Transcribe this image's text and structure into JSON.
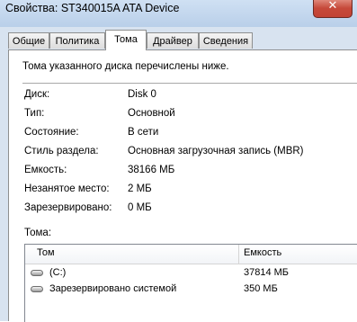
{
  "window": {
    "title": "Свойства: ST340015A ATA Device",
    "close_symbol": "✕"
  },
  "tabs": [
    {
      "label": "Общие"
    },
    {
      "label": "Политика"
    },
    {
      "label": "Тома"
    },
    {
      "label": "Драйвер"
    },
    {
      "label": "Сведения"
    }
  ],
  "active_tab": "Тома",
  "volumes_page": {
    "description": "Тома указанного диска перечислены ниже.",
    "fields": [
      {
        "label": "Диск:",
        "value": "Disk 0"
      },
      {
        "label": "Тип:",
        "value": "Основной"
      },
      {
        "label": "Состояние:",
        "value": "В сети"
      },
      {
        "label": "Стиль раздела:",
        "value": "Основная загрузочная запись (MBR)"
      },
      {
        "label": "Емкость:",
        "value": "38166 МБ"
      },
      {
        "label": "Незанятое место:",
        "value": "2 МБ"
      },
      {
        "label": "Зарезервировано:",
        "value": "0 МБ"
      }
    ],
    "volumes_label": "Тома:",
    "table": {
      "columns": [
        "Том",
        "Емкость"
      ],
      "rows": [
        {
          "volume": "(C:)",
          "capacity": "37814 МБ",
          "icon": "drive-icon"
        },
        {
          "volume": "Зарезервировано системой",
          "capacity": "350 МБ",
          "icon": "drive-icon"
        }
      ]
    }
  }
}
